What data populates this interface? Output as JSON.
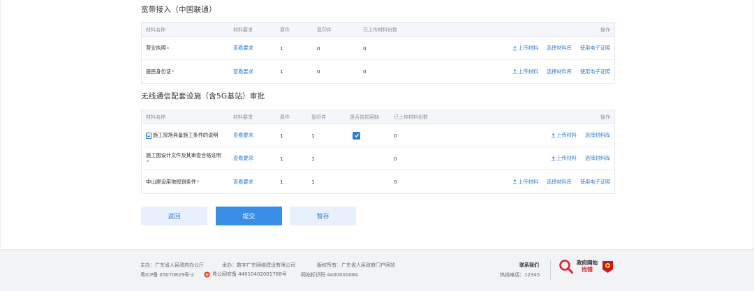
{
  "section1": {
    "title": "宽带接入（中国联通）",
    "headers": [
      "材料名称",
      "材料要求",
      "原件",
      "复印件",
      "已上传材料份数",
      "操作"
    ],
    "rows": [
      {
        "name": "营业执照",
        "req_mark": "*",
        "link": "查看要求",
        "original": "1",
        "copy": "0",
        "uploaded": "0",
        "op_upload": "上传材料",
        "op_select": "选择材料库",
        "op_e": "使用电子证照"
      },
      {
        "name": "居民身份证",
        "req_mark": "*",
        "link": "查看要求",
        "original": "1",
        "copy": "0",
        "uploaded": "0",
        "op_upload": "上传材料",
        "op_select": "选择材料库",
        "op_e": "使用电子证照"
      }
    ]
  },
  "section2": {
    "title": "无线通信配套设施（含5G基站）审批",
    "headers": [
      "材料名称",
      "材料要求",
      "原件",
      "复印件",
      "是否告知容缺",
      "已上传材料份数",
      "操作"
    ],
    "rows": [
      {
        "name": "施工现场具备施工条件的说明",
        "req_mark": "",
        "link": "查看要求",
        "original": "1",
        "copy": "1",
        "uploaded": "0",
        "op_upload": "上传材料",
        "op_select": "选择材料库"
      },
      {
        "name": "施工图设计文件及其审查合格证明",
        "req_mark": "*",
        "link": "查看要求",
        "original": "1",
        "copy": "1",
        "uploaded": "0",
        "op_upload": "上传材料",
        "op_select": "选择材料库"
      },
      {
        "name": "中山建设用地规划条件",
        "req_mark": "*",
        "link": "查看要求",
        "original": "1",
        "copy": "1",
        "uploaded": "0",
        "op_upload": "上传材料",
        "op_select": "选择材料库",
        "op_e": "使用电子证照"
      }
    ]
  },
  "buttons": {
    "back": "返回",
    "submit": "提交",
    "save": "暂存"
  },
  "footer": {
    "host": "主办：广东省人民政府办公厅",
    "org": "承办：数字广东网络建设有限公司",
    "copyright": "版权所有：广东省人民政府门户网站",
    "icp": "粤ICP备 05070829号-2",
    "police": "粤公网安备 44010402001768号",
    "site_code": "网站标识码 4400000084",
    "contact_title": "联系我们",
    "hotline": "热线电话：12345",
    "gov_badge_top": "政府网站",
    "gov_badge_bottom": "找错"
  },
  "colors": {
    "accent": "#2e7fd6",
    "primary_button": "#3a8ee6",
    "required": "#e3372f"
  }
}
